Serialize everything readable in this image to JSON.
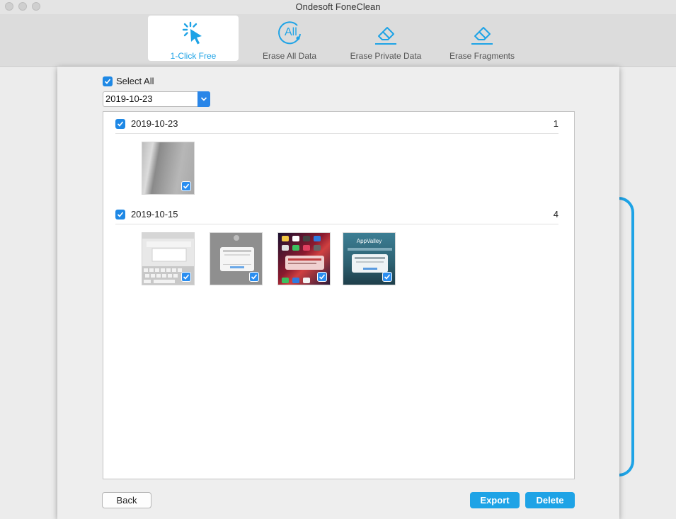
{
  "window": {
    "title": "Ondesoft FoneClean"
  },
  "toolbar": {
    "tabs": [
      {
        "label": "1-Click Free",
        "icon": "click-icon",
        "active": true
      },
      {
        "label": "Erase All Data",
        "icon": "all-icon",
        "icon_text": "All",
        "active": false
      },
      {
        "label": "Erase Private Data",
        "icon": "eraser-icon",
        "active": false
      },
      {
        "label": "Erase Fragments",
        "icon": "eraser-icon",
        "active": false
      }
    ]
  },
  "dialog": {
    "select_all_label": "Select All",
    "date_filter_value": "2019-10-23",
    "groups": [
      {
        "date": "2019-10-23",
        "count": "1",
        "checked": true,
        "thumbnails": [
          {
            "kind": "photo-gray",
            "checked": true
          }
        ]
      },
      {
        "date": "2019-10-15",
        "count": "4",
        "checked": true,
        "thumbnails": [
          {
            "kind": "screenshot-keyboard",
            "checked": true
          },
          {
            "kind": "screenshot-dialog",
            "checked": true
          },
          {
            "kind": "screenshot-homescreen",
            "checked": true
          },
          {
            "kind": "screenshot-appvalley",
            "checked": true,
            "text": "AppValley"
          }
        ]
      }
    ],
    "back_label": "Back",
    "export_label": "Export",
    "delete_label": "Delete"
  },
  "colors": {
    "accent": "#1ea3e6",
    "checkbox": "#1e88e5"
  }
}
